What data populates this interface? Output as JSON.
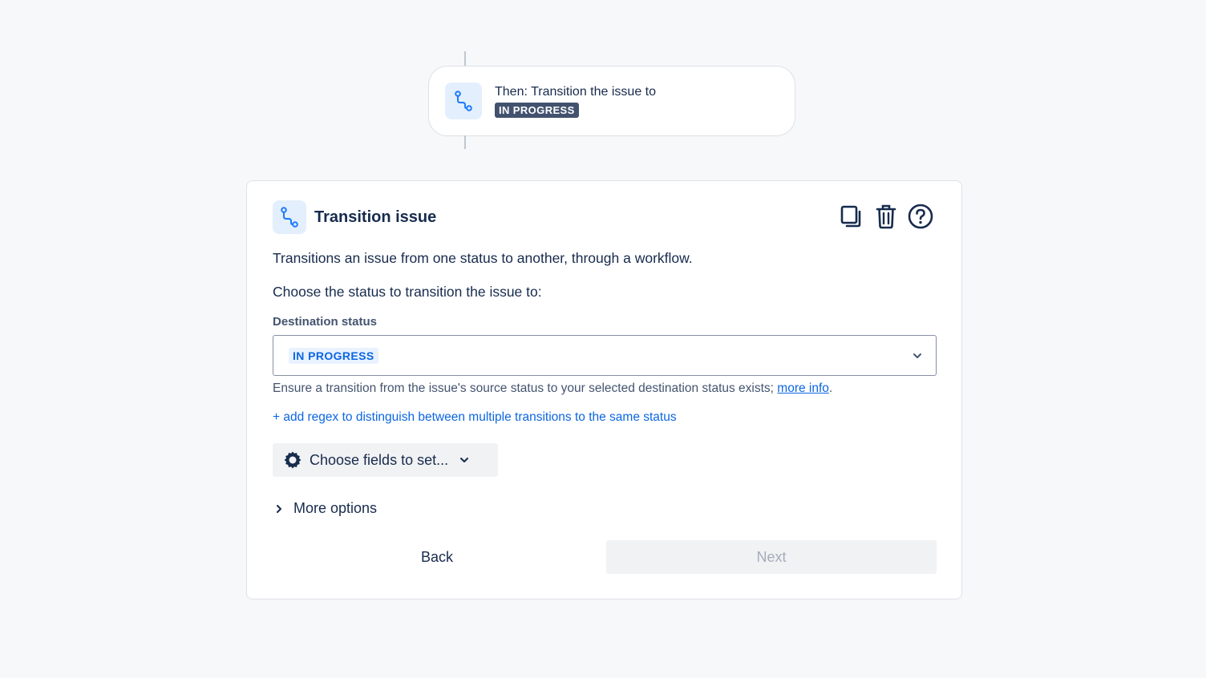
{
  "step": {
    "title": "Then: Transition the issue to",
    "status": "IN PROGRESS",
    "icon": "transition-icon"
  },
  "panel": {
    "title": "Transition issue",
    "icon": "transition-icon",
    "actions": [
      "duplicate-icon",
      "trash-icon",
      "help-icon"
    ],
    "description": "Transitions an issue from one status to another, through a workflow.",
    "choose_prompt": "Choose the status to transition the issue to:",
    "destination": {
      "label": "Destination status",
      "value": "IN PROGRESS"
    },
    "helper_text": "Ensure a transition from the issue's source status to your selected destination status exists; ",
    "helper_link": "more info",
    "helper_suffix": ".",
    "regex_link": "+ add regex to distinguish between multiple transitions to the same status",
    "fields_button": "Choose fields to set...",
    "more_options": "More options",
    "back_label": "Back",
    "next_label": "Next"
  },
  "colors": {
    "accent": "#0c66e4",
    "dark_lozenge": "#42526e",
    "icon_bg": "#e3effd",
    "text": "#172b4d"
  }
}
